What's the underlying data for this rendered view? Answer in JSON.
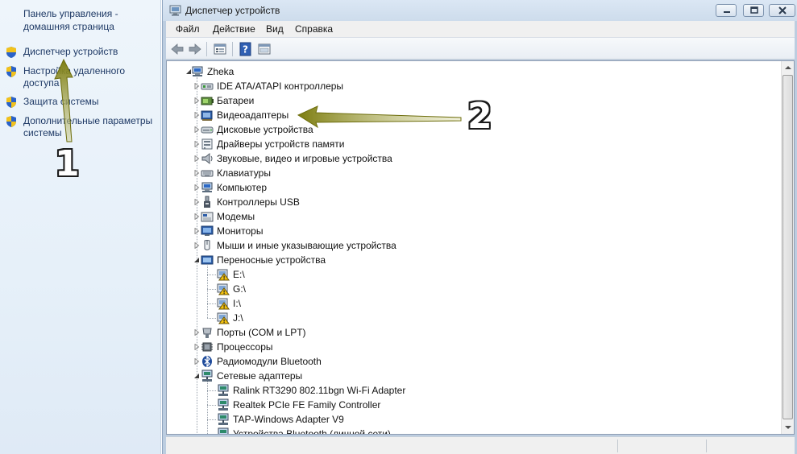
{
  "left_panel": {
    "home_link": "Панель управления - домашняя страница",
    "links": [
      {
        "label": "Диспетчер устройств",
        "icon": "shield-icon"
      },
      {
        "label": "Настройка удаленного доступа",
        "icon": "shield-icon"
      },
      {
        "label": "Защита системы",
        "icon": "shield-icon"
      },
      {
        "label": "Дополнительные параметры системы",
        "icon": "shield-icon"
      }
    ]
  },
  "window": {
    "title": "Диспетчер устройств",
    "menu": [
      "Файл",
      "Действие",
      "Вид",
      "Справка"
    ]
  },
  "tree": {
    "root": "Zheka",
    "rows": [
      {
        "label": "IDE ATA/ATAPI контроллеры",
        "icon": "ide-controller-icon",
        "level": 1,
        "expanded": false
      },
      {
        "label": "Батареи",
        "icon": "battery-icon",
        "level": 1,
        "expanded": false
      },
      {
        "label": "Видеоадаптеры",
        "icon": "display-adapter-icon",
        "level": 1,
        "expanded": false
      },
      {
        "label": "Дисковые устройства",
        "icon": "disk-drive-icon",
        "level": 1,
        "expanded": false
      },
      {
        "label": "Драйверы устройств памяти",
        "icon": "memory-driver-icon",
        "level": 1,
        "expanded": false
      },
      {
        "label": "Звуковые, видео и игровые устройства",
        "icon": "speaker-icon",
        "level": 1,
        "expanded": false
      },
      {
        "label": "Клавиатуры",
        "icon": "keyboard-icon",
        "level": 1,
        "expanded": false
      },
      {
        "label": "Компьютер",
        "icon": "computer-icon",
        "level": 1,
        "expanded": false
      },
      {
        "label": "Контроллеры USB",
        "icon": "usb-icon",
        "level": 1,
        "expanded": false
      },
      {
        "label": "Модемы",
        "icon": "modem-icon",
        "level": 1,
        "expanded": false
      },
      {
        "label": "Мониторы",
        "icon": "monitor-icon",
        "level": 1,
        "expanded": false
      },
      {
        "label": "Мыши и иные указывающие устройства",
        "icon": "mouse-icon",
        "level": 1,
        "expanded": false
      },
      {
        "label": "Переносные устройства",
        "icon": "portable-device-icon",
        "level": 1,
        "expanded": true
      },
      {
        "label": "E:\\",
        "icon": "warning-drive-icon",
        "level": 2
      },
      {
        "label": "G:\\",
        "icon": "warning-drive-icon",
        "level": 2
      },
      {
        "label": "I:\\",
        "icon": "warning-drive-icon",
        "level": 2
      },
      {
        "label": "J:\\",
        "icon": "warning-drive-icon",
        "level": 2
      },
      {
        "label": "Порты (COM и LPT)",
        "icon": "port-icon",
        "level": 1,
        "expanded": false
      },
      {
        "label": "Процессоры",
        "icon": "processor-icon",
        "level": 1,
        "expanded": false
      },
      {
        "label": "Радиомодули Bluetooth",
        "icon": "bluetooth-icon",
        "level": 1,
        "expanded": false
      },
      {
        "label": "Сетевые адаптеры",
        "icon": "network-adapter-icon",
        "level": 1,
        "expanded": true
      },
      {
        "label": "Ralink RT3290 802.11bgn Wi-Fi Adapter",
        "icon": "network-card-icon",
        "level": 2
      },
      {
        "label": "Realtek PCIe FE Family Controller",
        "icon": "network-card-icon",
        "level": 2
      },
      {
        "label": "TAP-Windows Adapter V9",
        "icon": "network-card-icon",
        "level": 2
      },
      {
        "label": "Устройства Bluetooth (личной сети)",
        "icon": "network-card-icon",
        "level": 2
      }
    ]
  },
  "annotations": {
    "marker_1": "1",
    "marker_2": "2",
    "arrow_color": "#8a8a1e"
  }
}
